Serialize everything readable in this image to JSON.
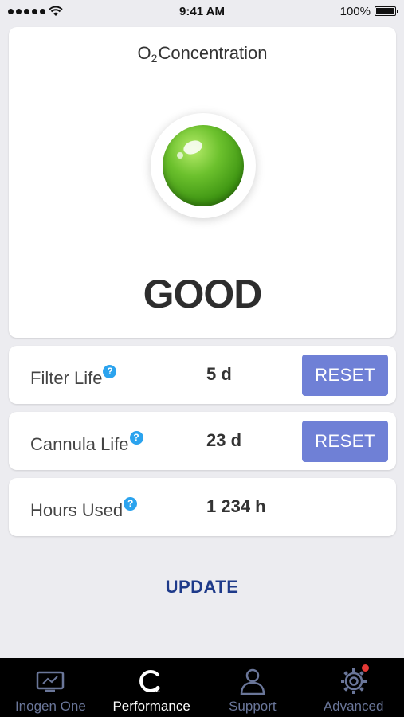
{
  "status_bar": {
    "time": "9:41 AM",
    "battery": "100%"
  },
  "o2_card": {
    "title_o": "O",
    "title_sub": "2",
    "title_rest": "Concentration",
    "indicator_color": "#4caf1c",
    "status": "GOOD"
  },
  "rows": [
    {
      "label": "Filter Life",
      "help": "?",
      "value": "5 d",
      "reset_label": "RESET"
    },
    {
      "label": "Cannula Life",
      "help": "?",
      "value": "23 d",
      "reset_label": "RESET"
    },
    {
      "label": "Hours Used",
      "help": "?",
      "value": "1 234 h"
    }
  ],
  "update_label": "UPDATE",
  "tabs": [
    {
      "label": "Inogen One",
      "icon": "monitor-icon",
      "active": false
    },
    {
      "label": "Performance",
      "icon": "o2-icon",
      "active": true
    },
    {
      "label": "Support",
      "icon": "person-icon",
      "active": false
    },
    {
      "label": "Advanced",
      "icon": "gear-icon",
      "active": false,
      "badge": true
    }
  ],
  "colors": {
    "accent_button": "#6f80d6",
    "help_icon": "#2ba3ee",
    "update_text": "#1e3a8a",
    "tab_inactive": "#6a7699",
    "badge": "#e53935"
  }
}
